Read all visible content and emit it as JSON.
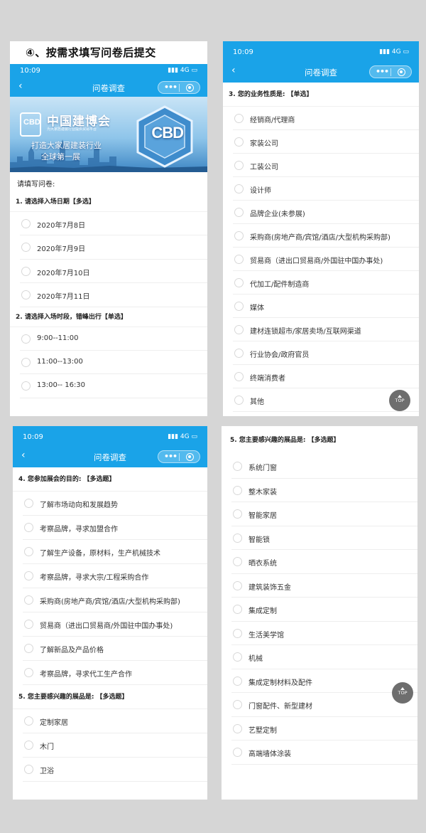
{
  "step_title": "④、按需求填写问卷后提交",
  "status": {
    "time": "10:09",
    "network": "4G"
  },
  "nav": {
    "title": "问卷调查",
    "back_label": "‹",
    "more_label": "•••"
  },
  "banner": {
    "brand": "中国建博会",
    "brand_sub": "为大家居建装行业提供贸易平台",
    "slogan1": "打造大家居建装行业",
    "slogan2": "全球第一展",
    "logo_text": "CBD",
    "hex_text": "CBD"
  },
  "intro": "请填写问卷:",
  "panel1": {
    "questions": [
      {
        "title": "1. 请选择入场日期【多选】",
        "options": [
          "2020年7月8日",
          "2020年7月9日",
          "2020年7月10日",
          "2020年7月11日"
        ]
      },
      {
        "title": "2. 请选择入场时段，错峰出行【单选】",
        "options": [
          "9:00--11:00",
          "11:00--13:00",
          "13:00-- 16:30"
        ]
      }
    ]
  },
  "panel2": {
    "question": "3. 您的业务性质是: 【单选】",
    "options": [
      "经销商/代理商",
      "家装公司",
      "工装公司",
      "设计师",
      "品牌企业(未参展)",
      "采购商(房地产商/宾馆/酒店/大型机构采购部)",
      "贸易商（进出口贸易商/外国驻中国办事处)",
      "代加工/配件制造商",
      "媒体",
      "建材连锁超市/家居卖场/互联网渠道",
      "行业协会/政府官员",
      "终端消费者",
      "其他"
    ],
    "top_label": "TOP"
  },
  "panel3": {
    "questions": [
      {
        "title": "4. 您参加展会的目的: 【多选题】",
        "options": [
          "了解市场动向和发展趋势",
          "考察品牌，寻求加盟合作",
          "了解生产设备，原材料，生产机械技术",
          "考察品牌，寻求大宗/工程采购合作",
          "采购商(房地产商/宾馆/酒店/大型机构采购部)",
          "贸易商（进出口贸易商/外国驻中国办事处)",
          "了解新品及产品价格",
          "考察品牌，寻求代工生产合作"
        ]
      },
      {
        "title": "5. 您主要感兴趣的展品是: 【多选题】",
        "options": [
          "定制家居",
          "木门",
          "卫浴"
        ]
      }
    ]
  },
  "panel4": {
    "question": "5. 您主要感兴趣的展品是: 【多选题】",
    "options": [
      "系统门窗",
      "整木家装",
      "智能家居",
      "智能锁",
      "晒衣系统",
      "建筑装饰五金",
      "集成定制",
      "生活美学馆",
      "机械",
      "集成定制材料及配件",
      "门窗配件、新型建材",
      "艺墅定制",
      "高端墙体涂装"
    ],
    "top_label": "TOP"
  },
  "colors": {
    "header_blue": "#1aa3e8",
    "top_button": "#6e6e6e"
  }
}
